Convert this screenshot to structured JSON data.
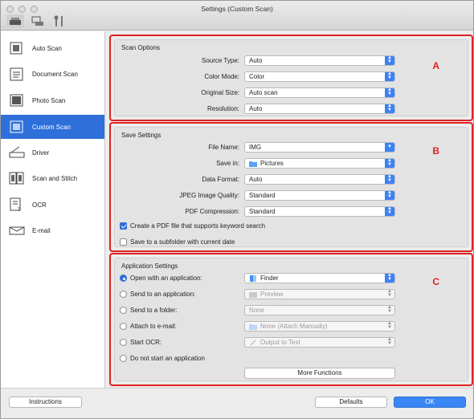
{
  "window": {
    "title": "Settings (Custom Scan)"
  },
  "sidebar": {
    "items": [
      {
        "label": "Auto Scan",
        "icon": "auto-scan-icon"
      },
      {
        "label": "Document Scan",
        "icon": "document-scan-icon"
      },
      {
        "label": "Photo Scan",
        "icon": "photo-scan-icon"
      },
      {
        "label": "Custom Scan",
        "icon": "custom-scan-icon",
        "active": true
      },
      {
        "label": "Driver",
        "icon": "driver-icon"
      },
      {
        "label": "Scan and Stitch",
        "icon": "scan-stitch-icon"
      },
      {
        "label": "OCR",
        "icon": "ocr-icon"
      },
      {
        "label": "E-mail",
        "icon": "email-icon"
      }
    ]
  },
  "scan_options": {
    "title": "Scan Options",
    "letter": "A",
    "source_type": {
      "label": "Source Type:",
      "value": "Auto"
    },
    "color_mode": {
      "label": "Color Mode:",
      "value": "Color"
    },
    "original_size": {
      "label": "Original Size:",
      "value": "Auto scan"
    },
    "resolution": {
      "label": "Resolution:",
      "value": "Auto"
    }
  },
  "save_settings": {
    "title": "Save Settings",
    "letter": "B",
    "file_name": {
      "label": "File Name:",
      "value": "IMG"
    },
    "save_in": {
      "label": "Save in:",
      "value": "Pictures"
    },
    "data_format": {
      "label": "Data Format:",
      "value": "Auto"
    },
    "jpeg_quality": {
      "label": "JPEG Image Quality:",
      "value": "Standard"
    },
    "pdf_compression": {
      "label": "PDF Compression:",
      "value": "Standard"
    },
    "create_pdf_keyword": {
      "label": "Create a PDF file that supports keyword search",
      "checked": true
    },
    "save_subfolder": {
      "label": "Save to a subfolder with current date",
      "checked": false
    }
  },
  "app_settings": {
    "title": "Application Settings",
    "letter": "C",
    "open_with_app": {
      "label": "Open with an application:",
      "value": "Finder",
      "selected": true
    },
    "send_to_app": {
      "label": "Send to an application:",
      "value": "Preview"
    },
    "send_to_folder": {
      "label": "Send to a folder:",
      "value": "None"
    },
    "attach_email": {
      "label": "Attach to e-mail:",
      "value": "None (Attach Manually)"
    },
    "start_ocr": {
      "label": "Start OCR:",
      "value": "Output to Text"
    },
    "no_app": {
      "label": "Do not start an application"
    },
    "more_functions": "More Functions"
  },
  "footer": {
    "instructions": "Instructions",
    "defaults": "Defaults",
    "ok": "OK"
  },
  "colors": {
    "accent": "#2e6fd9",
    "highlight_border": "#e02020"
  }
}
